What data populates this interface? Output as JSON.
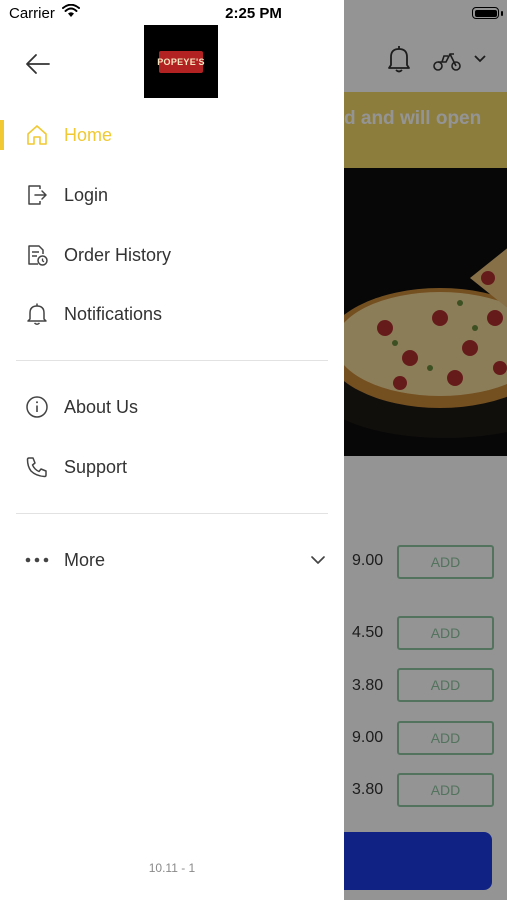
{
  "status_bar": {
    "carrier": "Carrier",
    "time": "2:25 PM"
  },
  "drawer": {
    "logo_text": "POPEYE'S",
    "items": [
      {
        "label": "Home",
        "icon": "home-icon",
        "active": true
      },
      {
        "label": "Login",
        "icon": "login-icon"
      },
      {
        "label": "Order History",
        "icon": "order-history-icon"
      },
      {
        "label": "Notifications",
        "icon": "bell-icon"
      },
      {
        "label": "About Us",
        "icon": "info-icon"
      },
      {
        "label": "Support",
        "icon": "phone-icon"
      },
      {
        "label": "More",
        "icon": "more-dots-icon"
      }
    ],
    "version": "10.11 - 1"
  },
  "background": {
    "banner_text": "d and will open",
    "products": [
      {
        "price": "9.00",
        "button": "ADD"
      },
      {
        "price": "4.50",
        "button": "ADD"
      },
      {
        "price": "3.80",
        "button": "ADD"
      },
      {
        "price": "9.00",
        "button": "ADD"
      },
      {
        "price": "3.80",
        "button": "ADD"
      }
    ]
  },
  "colors": {
    "accent": "#f0c933",
    "banner": "#f1d86a",
    "add_button": "#8fc7a2",
    "cta": "#1c3be2",
    "text": "#333333"
  }
}
